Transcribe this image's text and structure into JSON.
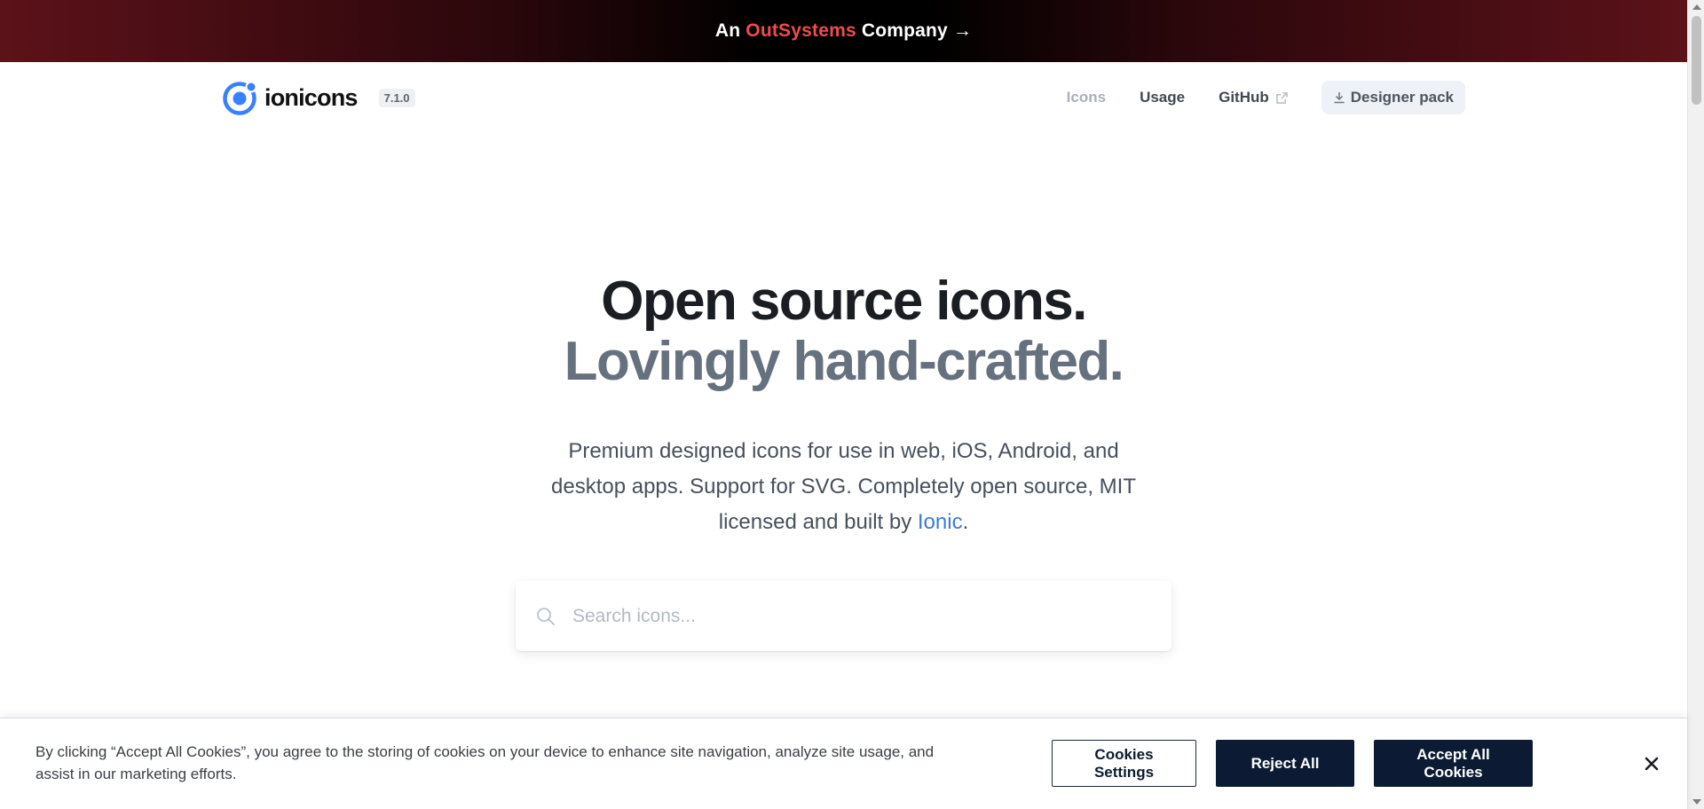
{
  "banner": {
    "prefix": "An",
    "brand": "OutSystems",
    "suffix": "Company",
    "arrow": "→",
    "brand_color": "#ef4c4c"
  },
  "nav": {
    "logo_text": "ionicons",
    "version": "7.1.0",
    "links": [
      {
        "label": "Icons",
        "active": true
      },
      {
        "label": "Usage"
      },
      {
        "label": "GitHub",
        "icon": "external-link-icon"
      }
    ],
    "designer_button": {
      "label": "Designer pack",
      "icon": "download-icon"
    }
  },
  "hero": {
    "title_line1": "Open source icons.",
    "title_line2": "Lovingly hand-crafted.",
    "description_part1": "Premium designed icons for use in web, iOS, Android, and desktop apps. Support for SVG. Completely open source, MIT licensed and built by",
    "description_link": "Ionic",
    "description_end": ".",
    "link_color": "#3d7ad6"
  },
  "search": {
    "placeholder": "Search icons...",
    "icon": "search-icon",
    "value": ""
  },
  "cookie_banner": {
    "text": "By clicking “Accept All Cookies”, you agree to the storing of cookies on your device to enhance site navigation, analyze site usage, and assist in our marketing efforts.",
    "settings_label": "Cookies Settings",
    "reject_label": "Reject All",
    "accept_label": "Accept All Cookies",
    "close_icon": "close-icon",
    "button_color": "#0c1b33"
  }
}
